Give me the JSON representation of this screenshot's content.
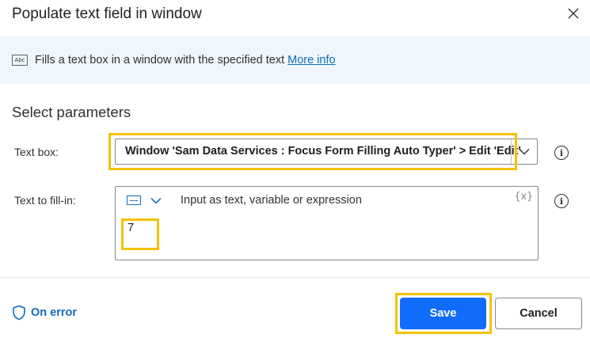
{
  "dialog": {
    "title": "Populate text field in window",
    "close_icon": "close-icon"
  },
  "banner": {
    "icon": "abc-icon",
    "icon_text": "Abc",
    "description": "Fills a text box in a window with the specified text",
    "link_label": "More info"
  },
  "parameters": {
    "heading": "Select parameters",
    "text_box": {
      "label": "Text box:",
      "value": "Window 'Sam Data Services : Focus Form Filling Auto Typer' > Edit 'Edit'",
      "dropdown_icon": "chevron-down-icon",
      "info_icon": "info-icon"
    },
    "text_to_fill": {
      "label": "Text to fill-in:",
      "mode_icon": "text-mode-icon",
      "mode_dropdown_icon": "chevron-down-icon",
      "placeholder": "Input as text, variable or expression",
      "variable_icon_text": "{x}",
      "value": "7",
      "info_icon": "info-icon"
    }
  },
  "footer": {
    "on_error_icon": "shield-icon",
    "on_error_label": "On error",
    "save_label": "Save",
    "cancel_label": "Cancel"
  },
  "colors": {
    "accent": "#0f6cbd",
    "primary_button": "#0f6cfc",
    "banner_background": "#eff6fc",
    "highlight": "#f2c200"
  }
}
